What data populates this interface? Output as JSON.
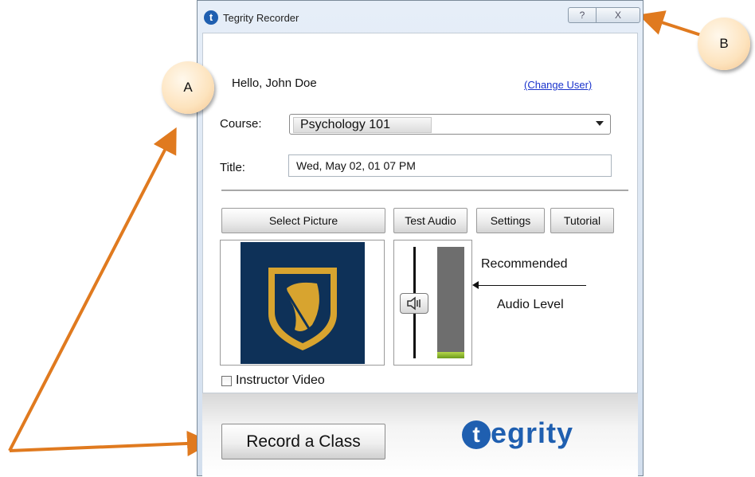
{
  "window": {
    "title": "Tegrity Recorder",
    "logo_letter": "t",
    "help_glyph": "?",
    "close_glyph": "X"
  },
  "greeting": "Hello, John Doe",
  "change_user": "(Change User)",
  "course": {
    "label": "Course:",
    "value": "Psychology 101"
  },
  "title_field": {
    "label": "Title:",
    "value": "Wed, May 02, 01 07 PM"
  },
  "buttons": {
    "select_picture": "Select Picture",
    "test_audio": "Test Audio",
    "settings": "Settings",
    "tutorial": "Tutorial",
    "record": "Record a Class"
  },
  "audio": {
    "recommended": "Recommended",
    "level": "Audio Level",
    "meter_fraction": 0.06
  },
  "instructor_video": {
    "label": "Instructor Video",
    "checked": false
  },
  "brand": {
    "name": "egrity",
    "letter": "t",
    "color": "#1f5fb0"
  },
  "annotations": {
    "a": "A",
    "b": "B",
    "arrow_color": "#e07a1f"
  },
  "icons": {
    "speaker": "speaker-icon",
    "shield": "shield-logo"
  }
}
